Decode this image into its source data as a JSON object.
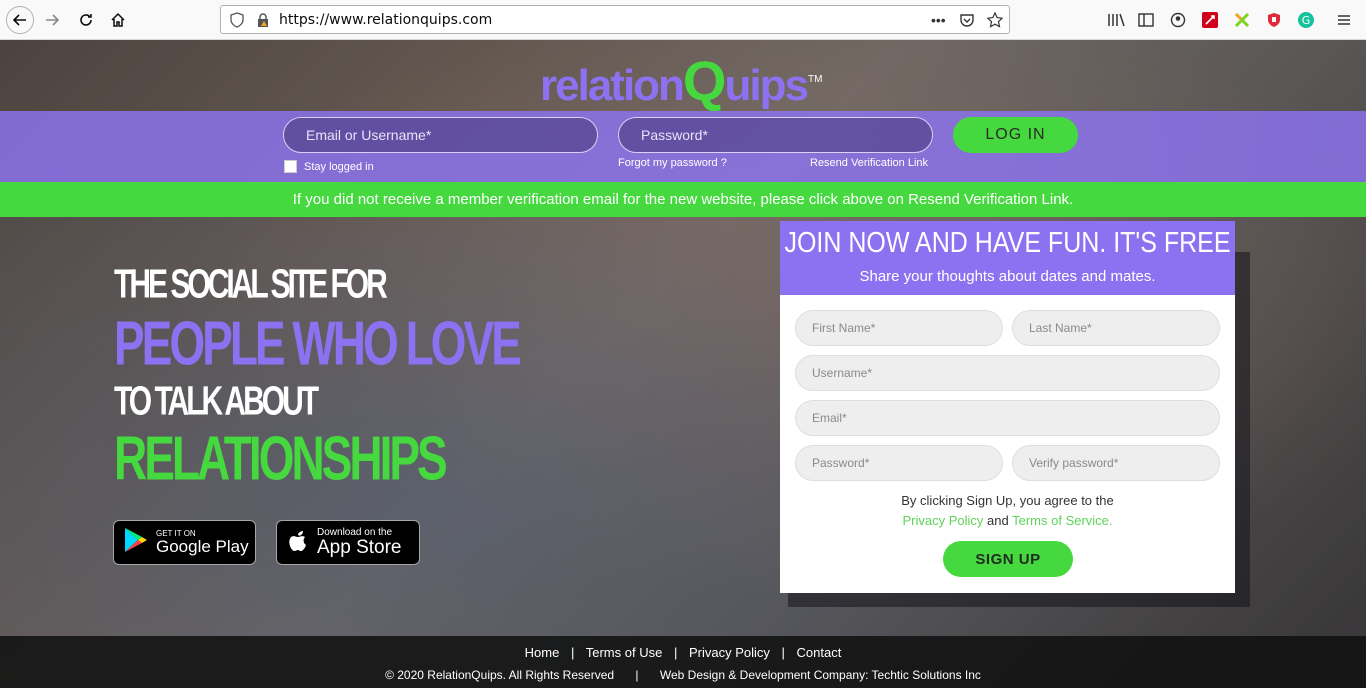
{
  "browser": {
    "url": "https://www.relationquips.com",
    "icons": [
      "back-icon",
      "forward-icon",
      "reload-icon",
      "home-icon",
      "shield-icon",
      "lock-icon",
      "more-icon",
      "pocket-icon",
      "star-icon",
      "library-icon",
      "sidebar-icon",
      "account-icon",
      "extension-icons",
      "menu-icon"
    ]
  },
  "logo": {
    "part1": "relation",
    "part2": "Q",
    "part3": "uips",
    "tm": "TM"
  },
  "login": {
    "email_placeholder": "Email or Username*",
    "password_placeholder": "Password*",
    "button": "LOG IN",
    "stay_logged": "Stay logged in",
    "forgot": "Forgot my password ?",
    "resend": "Resend Verification Link"
  },
  "notice": "If you did not receive a member verification email for the new website, please click above on Resend Verification Link.",
  "hero": {
    "line1": "THE SOCIAL SITE FOR",
    "line2": "PEOPLE WHO LOVE",
    "line3": "TO TALK ABOUT",
    "line4": "RELATIONSHIPS"
  },
  "stores": {
    "google_small": "GET IT ON",
    "google_big": "Google Play",
    "apple_small": "Download on the",
    "apple_big": "App Store"
  },
  "signup": {
    "title": "JOIN NOW AND HAVE FUN. IT'S FREE",
    "subtitle": "Share your thoughts about dates and mates.",
    "first_name": "First Name*",
    "last_name": "Last Name*",
    "username": "Username*",
    "email": "Email*",
    "password": "Password*",
    "verify": "Verify password*",
    "terms_pre": "By clicking Sign Up, you agree to the",
    "privacy": "Privacy Policy",
    "and": "and",
    "tos": "Terms of Service.",
    "button": "SIGN UP"
  },
  "footer": {
    "links": [
      "Home",
      "Terms of Use",
      "Privacy Policy",
      "Contact"
    ],
    "sep": "|",
    "copyright": "© 2020 RelationQuips. All Rights Reserved",
    "credit": "Web Design & Development Company: Techtic Solutions Inc"
  },
  "colors": {
    "purple": "#8c72f0",
    "green": "#46d93f"
  }
}
